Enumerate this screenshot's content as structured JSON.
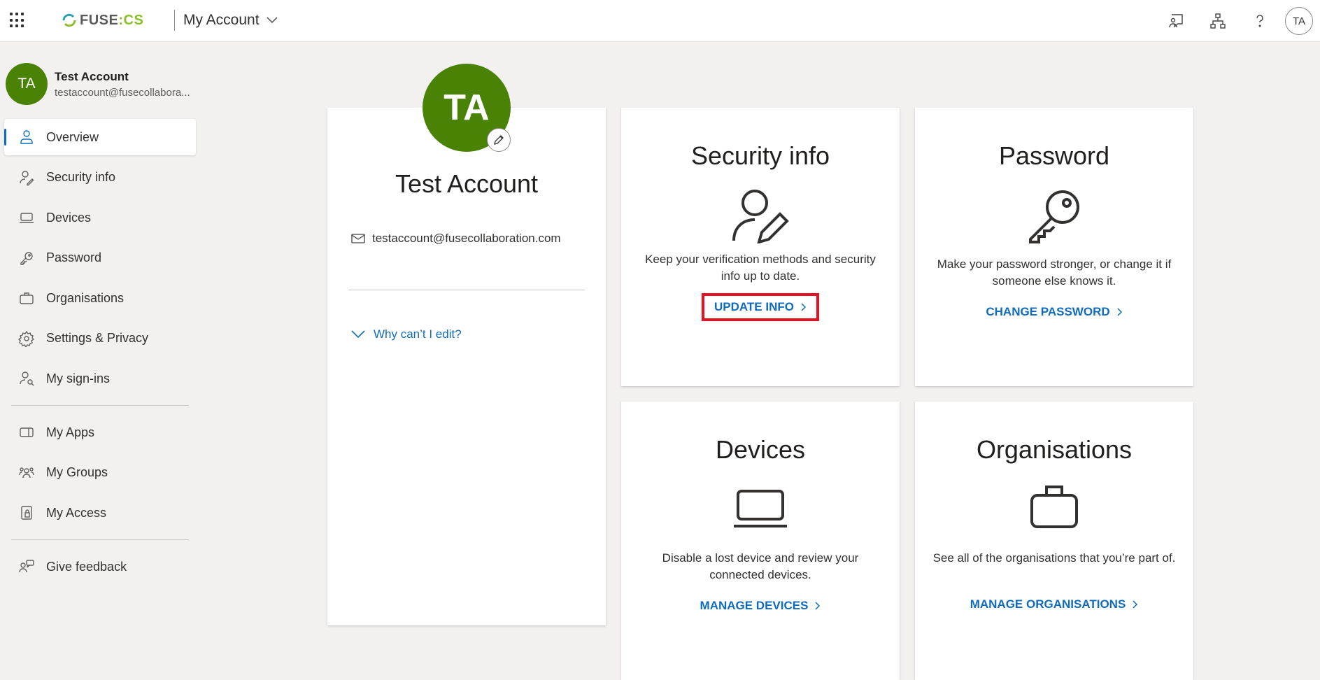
{
  "header": {
    "logo_text_a": "FUSE",
    "logo_text_b": ":CS",
    "app_title": "My Account",
    "avatar_initials": "TA",
    "icons": [
      "feedback-icon",
      "org-chart-icon",
      "help-icon"
    ]
  },
  "user": {
    "initials": "TA",
    "name": "Test Account",
    "email": "testaccount@fusecollabora..."
  },
  "sidebar": {
    "items": [
      {
        "label": "Overview",
        "icon": "person-icon",
        "active": true
      },
      {
        "label": "Security info",
        "icon": "person-key-icon"
      },
      {
        "label": "Devices",
        "icon": "laptop-icon"
      },
      {
        "label": "Password",
        "icon": "key-icon"
      },
      {
        "label": "Organisations",
        "icon": "briefcase-icon"
      },
      {
        "label": "Settings & Privacy",
        "icon": "gear-icon"
      },
      {
        "label": "My sign-ins",
        "icon": "person-sign-in-icon"
      }
    ],
    "apps": [
      {
        "label": "My Apps",
        "icon": "apps-icon"
      },
      {
        "label": "My Groups",
        "icon": "groups-icon"
      },
      {
        "label": "My Access",
        "icon": "lock-icon"
      }
    ],
    "feedback": {
      "label": "Give feedback",
      "icon": "feedback-icon"
    }
  },
  "profile": {
    "initials": "TA",
    "name": "Test Account",
    "email": "testaccount@fusecollaboration.com",
    "why_edit": "Why can’t I edit?"
  },
  "tiles": {
    "security": {
      "title": "Security info",
      "desc": "Keep your verification methods and security info up to date.",
      "link": "UPDATE INFO"
    },
    "password": {
      "title": "Password",
      "desc": "Make your password stronger, or change it if someone else knows it.",
      "link": "CHANGE PASSWORD"
    },
    "devices": {
      "title": "Devices",
      "desc": "Disable a lost device and review your connected devices.",
      "link": "MANAGE DEVICES"
    },
    "organisations": {
      "title": "Organisations",
      "desc": "See all of the organisations that you’re part of.",
      "link": "MANAGE ORGANISATIONS"
    }
  },
  "colors": {
    "accent": "#0f6cbd",
    "avatar": "#498205",
    "highlight": "#e81123"
  }
}
